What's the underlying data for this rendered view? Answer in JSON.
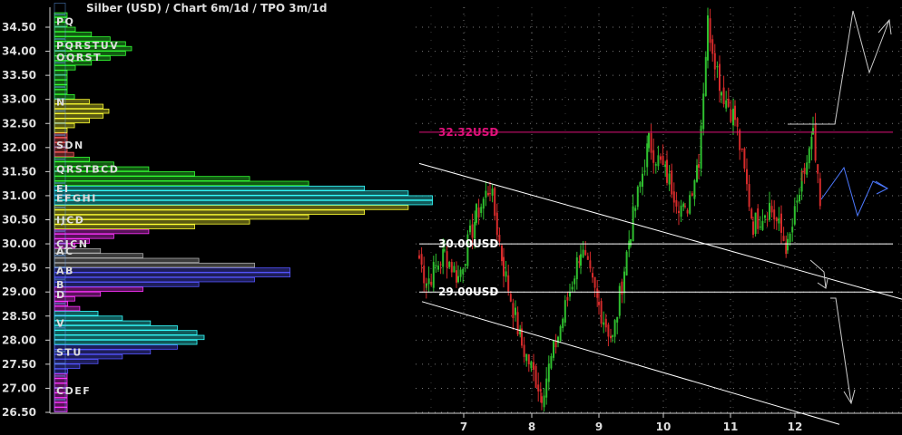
{
  "header": {
    "title": "Silber (USD) /  Chart 6m/1d / TPO 3m/1d"
  },
  "chart_data": {
    "type": "candlestick",
    "title": "Silber (USD) /  Chart 6m/1d / TPO 3m/1d",
    "y_ticks": [
      "26.50",
      "27.00",
      "27.50",
      "28.00",
      "28.50",
      "29.00",
      "29.50",
      "30.00",
      "30.50",
      "31.00",
      "31.50",
      "32.00",
      "32.50",
      "33.00",
      "33.50",
      "34.00",
      "34.50"
    ],
    "ylim": [
      26.5,
      34.5
    ],
    "x_ticks": [
      "7",
      "8",
      "9",
      "10",
      "11",
      "12"
    ],
    "levels": [
      {
        "label": "32.32USD",
        "value": 32.32,
        "color": "#e0117a"
      },
      {
        "label": "30.00USD",
        "value": 30.0,
        "color": "#ffffff"
      },
      {
        "label": "29.00USD",
        "value": 29.0,
        "color": "#ffffff"
      }
    ],
    "colors": {
      "up": "#2fbf2f",
      "down": "#d62b2b",
      "profile_hot": "#ff5a5a",
      "profile_yellow": "#ffff33",
      "profile_green": "#33ff33",
      "profile_blue": "#5555ff",
      "profile_cyan": "#33ffff",
      "profile_magenta": "#ff33ff",
      "profile_gray": "#aaaaaa"
    },
    "tpo_letters": [
      {
        "price": 34.62,
        "letters": "PQ"
      },
      {
        "price": 34.12,
        "letters": "PQRSTUV"
      },
      {
        "price": 33.88,
        "letters": "OQRST"
      },
      {
        "price": 32.95,
        "letters": "N"
      },
      {
        "price": 32.05,
        "letters": "SDN"
      },
      {
        "price": 31.55,
        "letters": "QRSTBCD"
      },
      {
        "price": 31.15,
        "letters": "EI"
      },
      {
        "price": 30.95,
        "letters": "EFGHI"
      },
      {
        "price": 30.5,
        "letters": "IJCD"
      },
      {
        "price": 30.0,
        "letters": "CJCN"
      },
      {
        "price": 29.85,
        "letters": "AC"
      },
      {
        "price": 29.45,
        "letters": "AB"
      },
      {
        "price": 29.15,
        "letters": "B"
      },
      {
        "price": 28.95,
        "letters": "D"
      },
      {
        "price": 28.35,
        "letters": "V"
      },
      {
        "price": 27.75,
        "letters": "STU"
      },
      {
        "price": 26.95,
        "letters": "CDEF"
      }
    ]
  }
}
